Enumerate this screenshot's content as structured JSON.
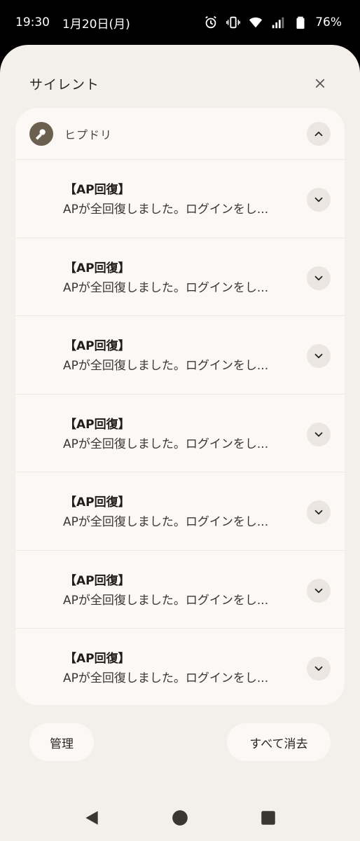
{
  "status_bar": {
    "time": "19:30",
    "date": "1月20日(月)",
    "battery": "76%",
    "icons": [
      "alarm-icon",
      "vibrate-icon",
      "wifi-icon",
      "signal-icon",
      "battery-icon"
    ]
  },
  "shade": {
    "title": "サイレント",
    "close_icon": "close-icon"
  },
  "app_group": {
    "app_name": "ヒプドリ",
    "icon": "microphone-icon",
    "collapse_icon": "chevron-up-icon"
  },
  "notifications": [
    {
      "title": "【AP回復】",
      "body": "APが全回復しました。ログインをし..."
    },
    {
      "title": "【AP回復】",
      "body": "APが全回復しました。ログインをし..."
    },
    {
      "title": "【AP回復】",
      "body": "APが全回復しました。ログインをし..."
    },
    {
      "title": "【AP回復】",
      "body": "APが全回復しました。ログインをし..."
    },
    {
      "title": "【AP回復】",
      "body": "APが全回復しました。ログインをし..."
    },
    {
      "title": "【AP回復】",
      "body": "APが全回復しました。ログインをし..."
    },
    {
      "title": "【AP回復】",
      "body": "APが全回復しました。ログインをし..."
    }
  ],
  "footer": {
    "manage_label": "管理",
    "clear_all_label": "すべて消去"
  },
  "nav": {
    "back_icon": "back-icon",
    "home_icon": "home-icon",
    "recents_icon": "recents-icon"
  },
  "colors": {
    "shade_bg": "#f3efeb",
    "card_bg": "#fbf8f5",
    "app_icon_bg": "#6b6050"
  }
}
